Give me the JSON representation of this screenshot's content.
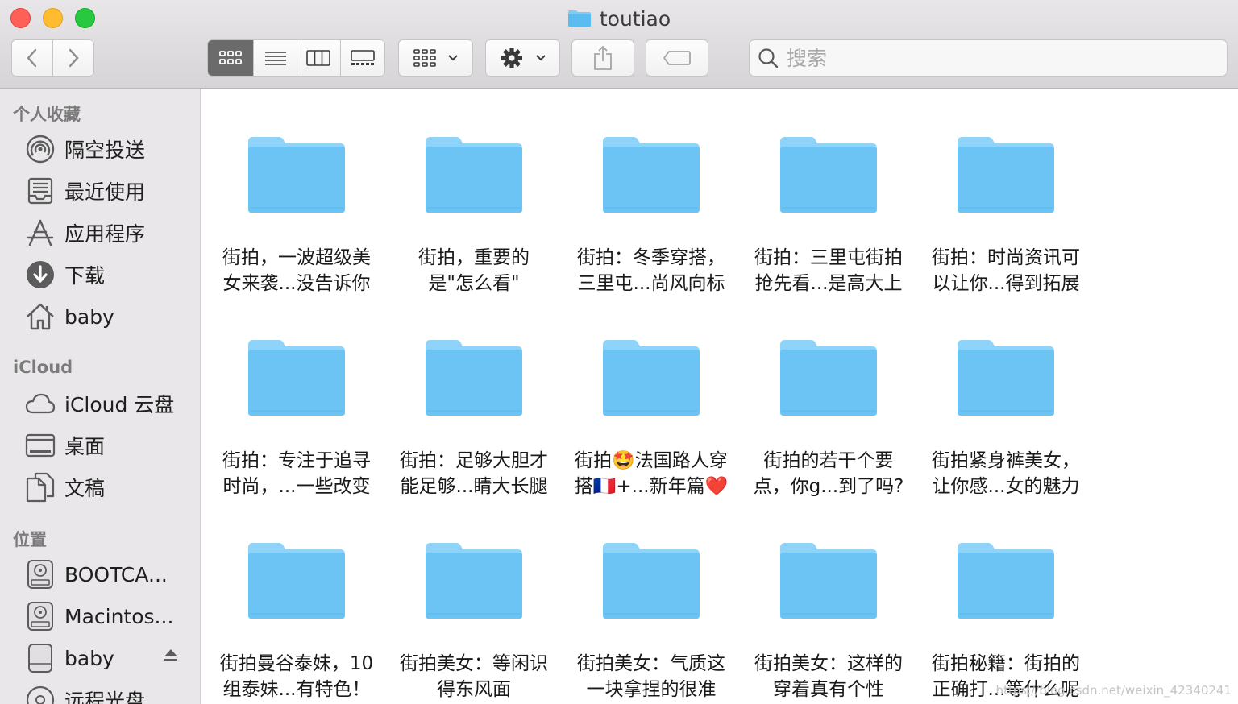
{
  "window": {
    "title": "toutiao",
    "title_icon": "folder-icon"
  },
  "toolbar": {
    "back_icon": "chevron-left-icon",
    "forward_icon": "chevron-right-icon",
    "views": [
      "icon-view",
      "list-view",
      "column-view",
      "gallery-view"
    ],
    "active_view": "icon-view",
    "group_icon": "group-by-icon",
    "action_icon": "gear-icon",
    "share_icon": "share-icon",
    "tag_icon": "tag-icon",
    "search_placeholder": "搜索"
  },
  "sidebar": {
    "sections": [
      {
        "heading": "个人收藏",
        "items": [
          {
            "label": "隔空投送",
            "icon": "airdrop-icon"
          },
          {
            "label": "最近使用",
            "icon": "recents-icon"
          },
          {
            "label": "应用程序",
            "icon": "applications-icon"
          },
          {
            "label": "下载",
            "icon": "downloads-icon"
          },
          {
            "label": "baby",
            "icon": "home-icon"
          }
        ]
      },
      {
        "heading": "iCloud",
        "items": [
          {
            "label": "iCloud 云盘",
            "icon": "cloud-icon"
          },
          {
            "label": "桌面",
            "icon": "desktop-icon"
          },
          {
            "label": "文稿",
            "icon": "documents-icon"
          }
        ]
      },
      {
        "heading": "位置",
        "items": [
          {
            "label": "BOOTCA...",
            "icon": "hard-drive-icon"
          },
          {
            "label": "Macintos...",
            "icon": "hard-drive-icon"
          },
          {
            "label": "baby",
            "icon": "external-drive-icon",
            "eject": true
          },
          {
            "label": "远程光盘",
            "icon": "remote-disc-icon"
          }
        ]
      }
    ]
  },
  "folders": [
    {
      "label": "街拍，一波超级美\n女来袭...没告诉你"
    },
    {
      "label": "街拍，重要的\n是\"怎么看\""
    },
    {
      "label": "街拍：冬季穿搭，\n三里屯...尚风向标"
    },
    {
      "label": "街拍：三里屯街拍\n抢先看...是高大上"
    },
    {
      "label": "街拍：时尚资讯可\n以让你...得到拓展"
    },
    {
      "label": "街拍：专注于追寻\n时尚，...一些改变"
    },
    {
      "label": "街拍：足够大胆才\n能足够...睛大长腿"
    },
    {
      "label": "街拍🤩法国路人穿\n搭🇫🇷+...新年篇❤️"
    },
    {
      "label": "街拍的若干个要\n点，你g...到了吗?"
    },
    {
      "label": "街拍紧身裤美女，\n让你感...女的魅力"
    },
    {
      "label": "街拍曼谷泰妹，10\n组泰妹...有特色！"
    },
    {
      "label": "街拍美女：等闲识\n得东风面"
    },
    {
      "label": "街拍美女：气质这\n一块拿捏的很准"
    },
    {
      "label": "街拍美女：这样的\n穿着真有个性"
    },
    {
      "label": "街拍秘籍：街拍的\n正确打...等什么呢"
    }
  ],
  "watermark": "https://blog.csdn.net/weixin_42340241",
  "colors": {
    "folder_body": "#6cc4f5",
    "folder_tab": "#8fd3f8",
    "sidebar_bg": "#e9e7e9",
    "toolbar_bg": "#dcdadc",
    "active_view_bg": "#6b6b6b"
  }
}
